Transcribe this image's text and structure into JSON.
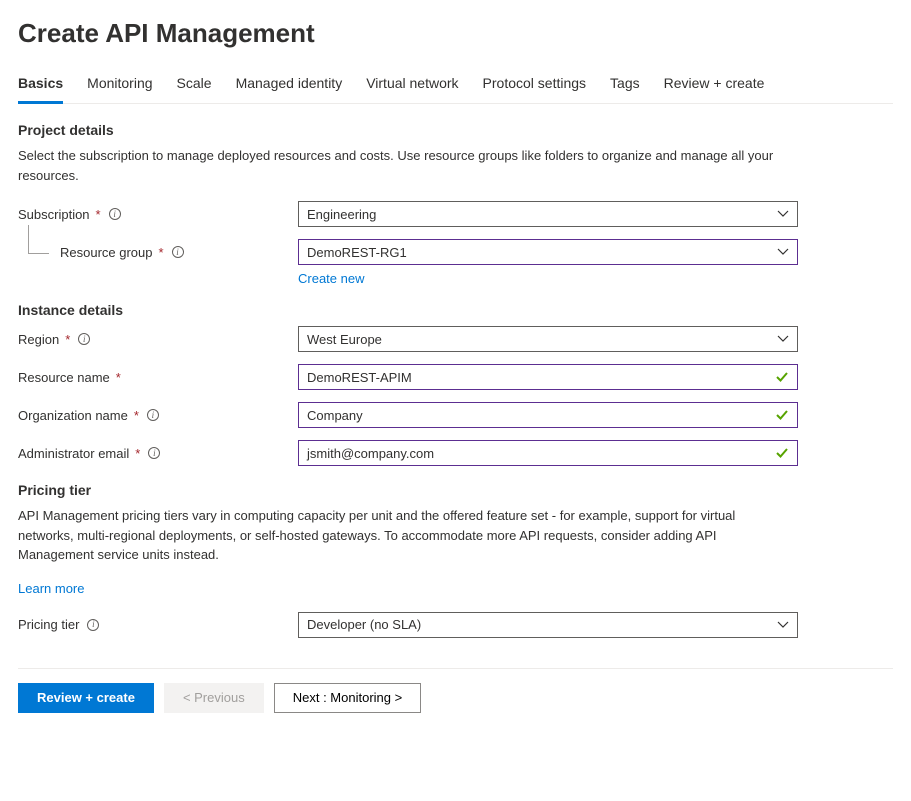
{
  "page_title": "Create API Management",
  "tabs": [
    {
      "label": "Basics",
      "active": true
    },
    {
      "label": "Monitoring",
      "active": false
    },
    {
      "label": "Scale",
      "active": false
    },
    {
      "label": "Managed identity",
      "active": false
    },
    {
      "label": "Virtual network",
      "active": false
    },
    {
      "label": "Protocol settings",
      "active": false
    },
    {
      "label": "Tags",
      "active": false
    },
    {
      "label": "Review + create",
      "active": false
    }
  ],
  "project_details": {
    "heading": "Project details",
    "description": "Select the subscription to manage deployed resources and costs. Use resource groups like folders to organize and manage all your resources.",
    "subscription": {
      "label": "Subscription",
      "value": "Engineering"
    },
    "resource_group": {
      "label": "Resource group",
      "value": "DemoREST-RG1",
      "create_new": "Create new"
    }
  },
  "instance_details": {
    "heading": "Instance details",
    "region": {
      "label": "Region",
      "value": "West Europe"
    },
    "resource_name": {
      "label": "Resource name",
      "value": "DemoREST-APIM"
    },
    "organization_name": {
      "label": "Organization name",
      "value": "Company"
    },
    "admin_email": {
      "label": "Administrator email",
      "value": "jsmith@company.com"
    }
  },
  "pricing_tier": {
    "heading": "Pricing tier",
    "description": "API Management pricing tiers vary in computing capacity per unit and the offered feature set - for example, support for virtual networks, multi-regional deployments, or self-hosted gateways. To accommodate more API requests, consider adding API Management service units instead.",
    "learn_more": "Learn more",
    "label": "Pricing tier",
    "value": "Developer (no SLA)"
  },
  "footer": {
    "review_create": "Review + create",
    "previous": "< Previous",
    "next": "Next : Monitoring >"
  }
}
